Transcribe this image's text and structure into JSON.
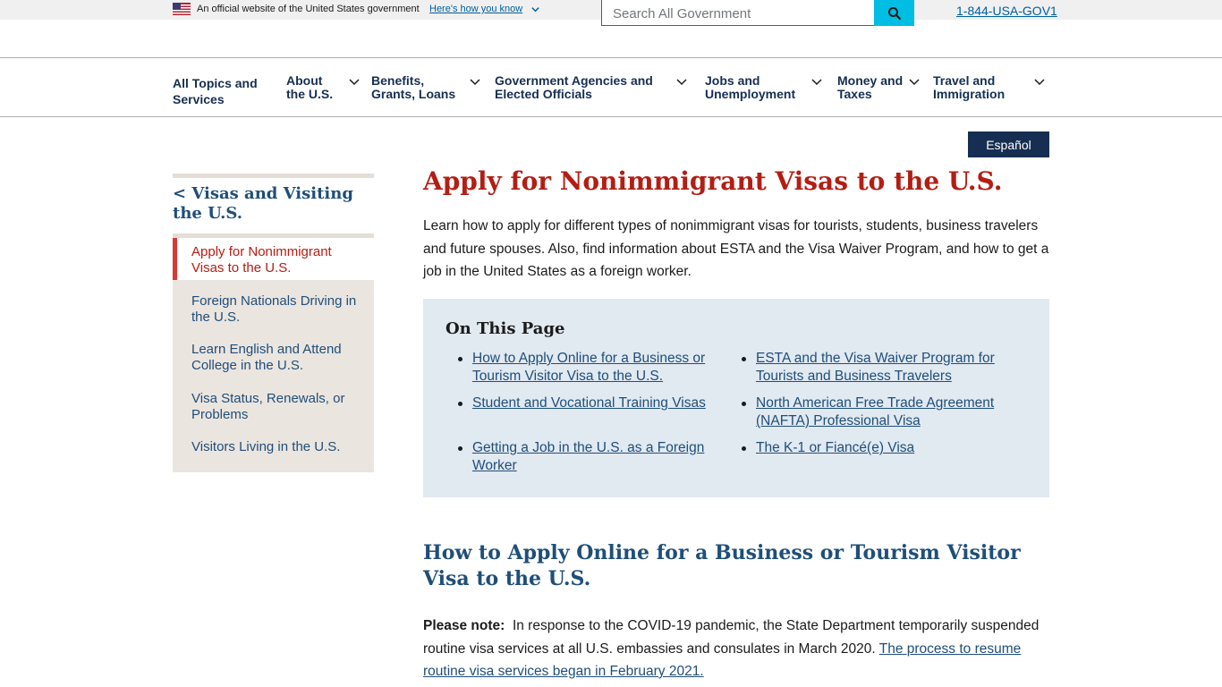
{
  "banner": {
    "text": "An official website of the United States government",
    "link": "Here's how you know"
  },
  "search": {
    "placeholder": "Search All Government"
  },
  "phone": "1-844-USA-GOV1",
  "nav": [
    {
      "line1": "All Topics and",
      "line2": "Services",
      "has_chevron": false
    },
    {
      "line1": "About",
      "line2": "the U.S.",
      "has_chevron": true
    },
    {
      "line1": "Benefits,",
      "line2": "Grants, Loans",
      "has_chevron": true
    },
    {
      "line1": "Government Agencies and",
      "line2": "Elected Officials",
      "has_chevron": true
    },
    {
      "line1": "Jobs and",
      "line2": "Unemployment",
      "has_chevron": true
    },
    {
      "line1": "Money and",
      "line2": "Taxes",
      "has_chevron": true
    },
    {
      "line1": "Travel and",
      "line2": "Immigration",
      "has_chevron": true
    }
  ],
  "language_button": "Español",
  "sidebar": {
    "parent": "< Visas and Visiting the U.S.",
    "items": [
      {
        "label": "Apply for Nonimmigrant Visas to the U.S.",
        "active": true
      },
      {
        "label": "Foreign Nationals Driving in the U.S.",
        "active": false
      },
      {
        "label": "Learn English and Attend College in the U.S.",
        "active": false
      },
      {
        "label": "Visa Status, Renewals, or Problems",
        "active": false
      },
      {
        "label": "Visitors Living in the U.S.",
        "active": false
      }
    ]
  },
  "main": {
    "title": "Apply for Nonimmigrant Visas to the U.S.",
    "intro": "Learn how to apply for different types of nonimmigrant visas for tourists, students, business travelers and future spouses. Also, find information about ESTA and the Visa Waiver Program, and how to get a job in the United States as a foreign worker.",
    "on_this_page": {
      "title": "On This Page",
      "links": [
        "How to Apply Online for a Business or Tourism Visitor Visa to the U.S.",
        "ESTA and the Visa Waiver Program for Tourists and Business Travelers",
        "Student and Vocational Training Visas",
        "North American Free Trade Agreement (NAFTA) Professional Visa",
        "Getting a Job in the U.S. as a Foreign Worker",
        "The K-1 or Fiancé(e) Visa"
      ]
    },
    "section_heading": "How to Apply Online for a Business or Tourism Visitor Visa to the U.S.",
    "note": {
      "label": "Please note:",
      "text": "In response to the COVID-19 pandemic, the State Department temporarily suspended routine visa services at all U.S. embassies and consulates in March 2020.",
      "link": "The process to resume routine visa services began in February 2021."
    }
  },
  "colors": {
    "navy": "#162e51",
    "link": "#1f4e79",
    "red": "#b31e14",
    "cyan": "#00bde3",
    "sidebar_bg": "#ebe5df",
    "otp_bg": "#e1e9f1"
  }
}
